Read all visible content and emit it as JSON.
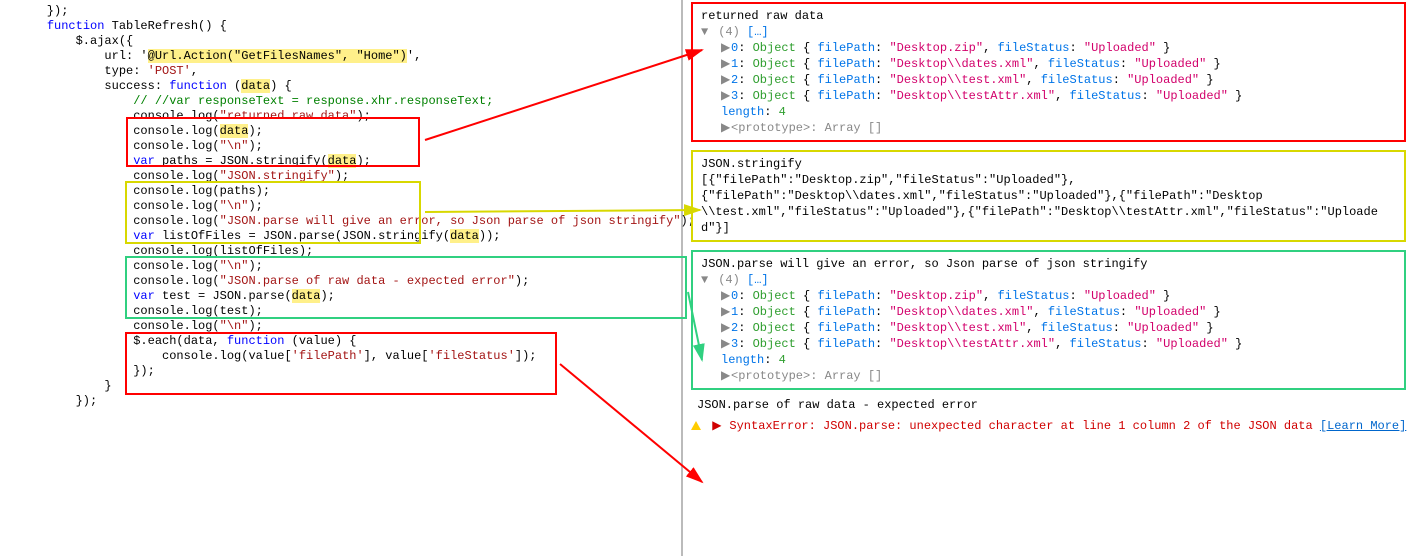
{
  "code": {
    "l0": "    });",
    "l1": "",
    "l2_pre": "    ",
    "l2_kw": "function",
    "l2_post": " TableRefresh() {",
    "l3": "        $.ajax({",
    "l4_pre": "            url: '",
    "l4_hl": "@Url.Action(\"GetFilesNames\", \"Home\")",
    "l4_post": "',",
    "l5_pre": "            type: ",
    "l5_str": "'POST'",
    "l5_post": ",",
    "l6_pre": "            success: ",
    "l6_kw": "function",
    "l6_mid": " (",
    "l6_hl": "data",
    "l6_post": ") {",
    "l7_pre": "                ",
    "l7_cmt": "// //var responseText = response.xhr.responseText;",
    "l8_pre": "                console.log(",
    "l8_str": "\"returned raw data\"",
    "l8_post": ");",
    "l9_pre": "                console.log(",
    "l9_hl": "data",
    "l9_post": ");",
    "l10_pre": "                console.log(",
    "l10_str": "\"\\n\"",
    "l10_post": ");",
    "l11": "",
    "l12_pre": "                ",
    "l12_kw": "var",
    "l12_mid": " paths = JSON.stringify(",
    "l12_hl": "data",
    "l12_post": ");",
    "l13_pre": "                console.log(",
    "l13_str": "\"JSON.stringify\"",
    "l13_post": ");",
    "l14": "                console.log(paths);",
    "l15_pre": "                console.log(",
    "l15_str": "\"\\n\"",
    "l15_post": ");",
    "l16": "",
    "l17_pre": "                console.log(",
    "l17_str": "\"JSON.parse will give an error, so Json parse of json stringify\"",
    "l17_post": ");",
    "l18_pre": "                ",
    "l18_kw": "var",
    "l18_mid": " listOfFiles = JSON.parse(JSON.stringify(",
    "l18_hl": "data",
    "l18_post": "));",
    "l19": "                console.log(listOfFiles);",
    "l20_pre": "                console.log(",
    "l20_str": "\"\\n\"",
    "l20_post": ");",
    "l21": "",
    "l22_pre": "                console.log(",
    "l22_str": "\"JSON.parse of raw data - expected error\"",
    "l22_post": ");",
    "l23_pre": "                ",
    "l23_kw": "var",
    "l23_mid": " test = JSON.parse(",
    "l23_hl": "data",
    "l23_post": ");",
    "l24": "                console.log(test);",
    "l25_pre": "                console.log(",
    "l25_str": "\"\\n\"",
    "l25_post": ");",
    "l26": "",
    "l27_pre": "                $.each(data, ",
    "l27_kw": "function",
    "l27_post": " (value) {",
    "l28_pre": "                    console.log(value[",
    "l28_str1": "'filePath'",
    "l28_mid": "], value[",
    "l28_str2": "'fileStatus'",
    "l28_post": "]);",
    "l29": "                });",
    "l30": "            }",
    "l31": "        });"
  },
  "console": {
    "block1_title": "returned raw data",
    "arrLabel": "(4)",
    "ellipsis": "[…]",
    "items": [
      {
        "idx": "0",
        "filePath": "\"Desktop.zip\"",
        "fileStatus": "\"Uploaded\""
      },
      {
        "idx": "1",
        "filePath": "\"Desktop\\\\dates.xml\"",
        "fileStatus": "\"Uploaded\""
      },
      {
        "idx": "2",
        "filePath": "\"Desktop\\\\test.xml\"",
        "fileStatus": "\"Uploaded\""
      },
      {
        "idx": "3",
        "filePath": "\"Desktop\\\\testAttr.xml\"",
        "fileStatus": "\"Uploaded\""
      }
    ],
    "lengthLabel": "length",
    "lengthVal": "4",
    "protoLabel": "<prototype>",
    "protoVal": "Array []",
    "block2_title": "JSON.stringify",
    "block2_body": "[{\"filePath\":\"Desktop.zip\",\"fileStatus\":\"Uploaded\"},\n{\"filePath\":\"Desktop\\\\dates.xml\",\"fileStatus\":\"Uploaded\"},{\"filePath\":\"Desktop\n\\\\test.xml\",\"fileStatus\":\"Uploaded\"},{\"filePath\":\"Desktop\\\\testAttr.xml\",\"fileStatus\":\"Uploaded\"}]",
    "block3_title": "JSON.parse will give an error, so Json parse of json stringify",
    "block4_title": "JSON.parse of raw data - expected error",
    "err_text": "SyntaxError: JSON.parse: unexpected character at line 1 column 2 of the JSON data",
    "learn_more": "[Learn More]"
  }
}
